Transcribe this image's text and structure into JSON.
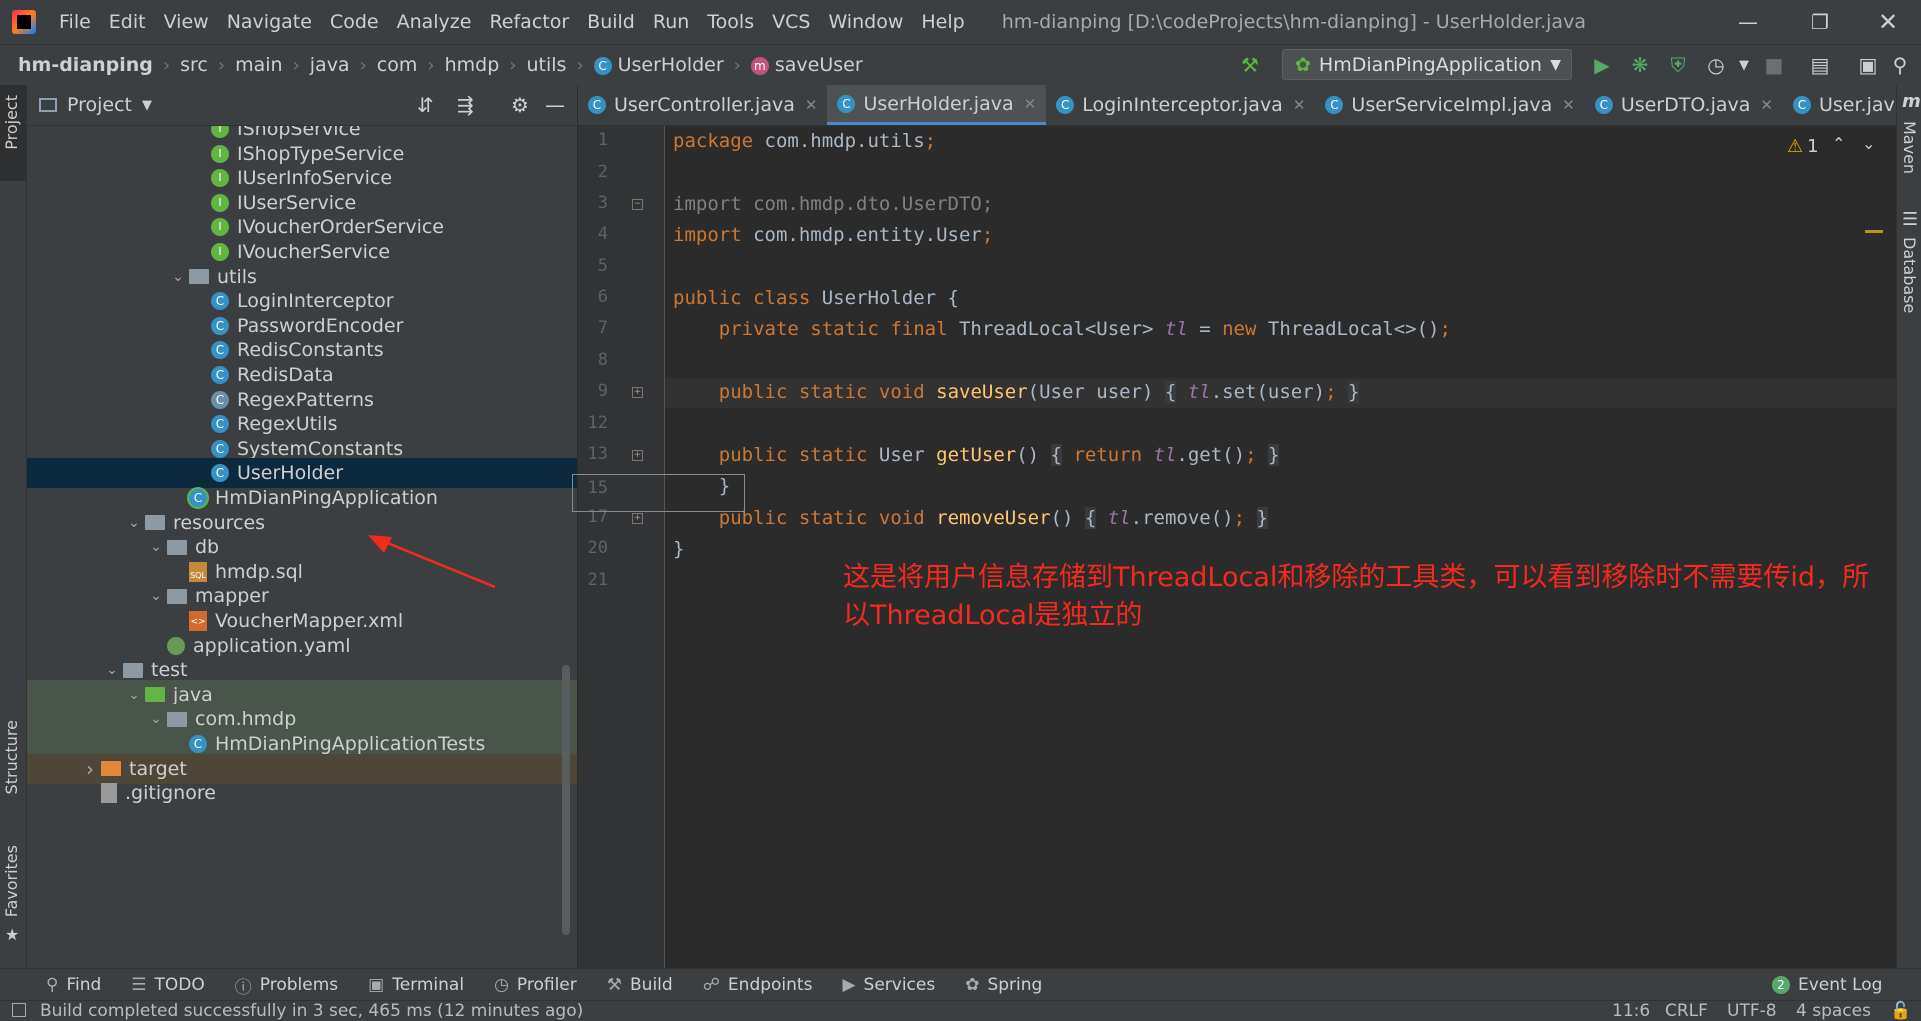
{
  "menubar": {
    "items": [
      "File",
      "Edit",
      "View",
      "Navigate",
      "Code",
      "Analyze",
      "Refactor",
      "Build",
      "Run",
      "Tools",
      "VCS",
      "Window",
      "Help"
    ],
    "title": "hm-dianping [D:\\codeProjects\\hm-dianping] - UserHolder.java"
  },
  "navbar": {
    "crumbs": [
      "hm-dianping",
      "src",
      "main",
      "java",
      "com",
      "hmdp",
      "utils",
      "UserHolder",
      "saveUser"
    ],
    "run_config": "HmDianPingApplication"
  },
  "project": {
    "title": "Project",
    "tree": [
      {
        "label": "IShopService",
        "kind": "interface",
        "indent": 7,
        "partial": true
      },
      {
        "label": "IShopTypeService",
        "kind": "interface",
        "indent": 7
      },
      {
        "label": "IUserInfoService",
        "kind": "interface",
        "indent": 7
      },
      {
        "label": "IUserService",
        "kind": "interface",
        "indent": 7
      },
      {
        "label": "IVoucherOrderService",
        "kind": "interface",
        "indent": 7
      },
      {
        "label": "IVoucherService",
        "kind": "interface",
        "indent": 7
      },
      {
        "label": "utils",
        "kind": "package",
        "indent": 6,
        "expanded": true
      },
      {
        "label": "LoginInterceptor",
        "kind": "class",
        "indent": 7
      },
      {
        "label": "PasswordEncoder",
        "kind": "class",
        "indent": 7
      },
      {
        "label": "RedisConstants",
        "kind": "class",
        "indent": 7
      },
      {
        "label": "RedisData",
        "kind": "class",
        "indent": 7
      },
      {
        "label": "RegexPatterns",
        "kind": "abstract",
        "indent": 7
      },
      {
        "label": "RegexUtils",
        "kind": "class",
        "indent": 7
      },
      {
        "label": "SystemConstants",
        "kind": "class",
        "indent": 7
      },
      {
        "label": "UserHolder",
        "kind": "class",
        "indent": 7,
        "selected": true
      },
      {
        "label": "HmDianPingApplication",
        "kind": "spring",
        "indent": 6
      },
      {
        "label": "resources",
        "kind": "resfolder",
        "indent": 4,
        "expanded": true
      },
      {
        "label": "db",
        "kind": "folder",
        "indent": 5,
        "expanded": true
      },
      {
        "label": "hmdp.sql",
        "kind": "sql",
        "indent": 6
      },
      {
        "label": "mapper",
        "kind": "folder",
        "indent": 5,
        "expanded": true
      },
      {
        "label": "VoucherMapper.xml",
        "kind": "xml",
        "indent": 6
      },
      {
        "label": "application.yaml",
        "kind": "yaml",
        "indent": 5
      },
      {
        "label": "test",
        "kind": "folder",
        "indent": 3,
        "expanded": true
      },
      {
        "label": "java",
        "kind": "testfolder",
        "indent": 4,
        "expanded": true,
        "bg": "green"
      },
      {
        "label": "com.hmdp",
        "kind": "package",
        "indent": 5,
        "expanded": true,
        "bg": "green"
      },
      {
        "label": "HmDianPingApplicationTests",
        "kind": "class",
        "indent": 6,
        "bg": "green"
      },
      {
        "label": "target",
        "kind": "orangefolder",
        "indent": 2,
        "collapsed": true,
        "bg": "brown"
      },
      {
        "label": ".gitignore",
        "kind": "git",
        "indent": 2
      }
    ]
  },
  "tabs": [
    {
      "label": "UserController.java",
      "active": false
    },
    {
      "label": "UserHolder.java",
      "active": true
    },
    {
      "label": "LoginInterceptor.java",
      "active": false
    },
    {
      "label": "UserServiceImpl.java",
      "active": false
    },
    {
      "label": "UserDTO.java",
      "active": false
    },
    {
      "label": "User.java",
      "active": false
    }
  ],
  "editor": {
    "line_numbers": [
      "1",
      "2",
      "3",
      "4",
      "5",
      "6",
      "7",
      "8",
      "9",
      "12",
      "13",
      "15",
      "17",
      "20",
      "21"
    ],
    "warning_count": "1",
    "annotation": "这是将用户信息存储到ThreadLocal和移除的工具类，可以看到移除时不需要传id，所以ThreadLocal是独立的"
  },
  "toolwindows": [
    "Find",
    "TODO",
    "Problems",
    "Terminal",
    "Profiler",
    "Build",
    "Endpoints",
    "Services",
    "Spring"
  ],
  "event_log": {
    "count": "2",
    "label": "Event Log"
  },
  "status": {
    "message": "Build completed successfully in 3 sec, 465 ms (12 minutes ago)",
    "position": "11:6",
    "line_sep": "CRLF",
    "encoding": "UTF-8",
    "indent": "4 spaces"
  },
  "stripes": {
    "left_top": "Project",
    "left_mid": "Structure",
    "left_bottom": "Favorites",
    "right_top": "Maven",
    "right_mid": "Database"
  }
}
